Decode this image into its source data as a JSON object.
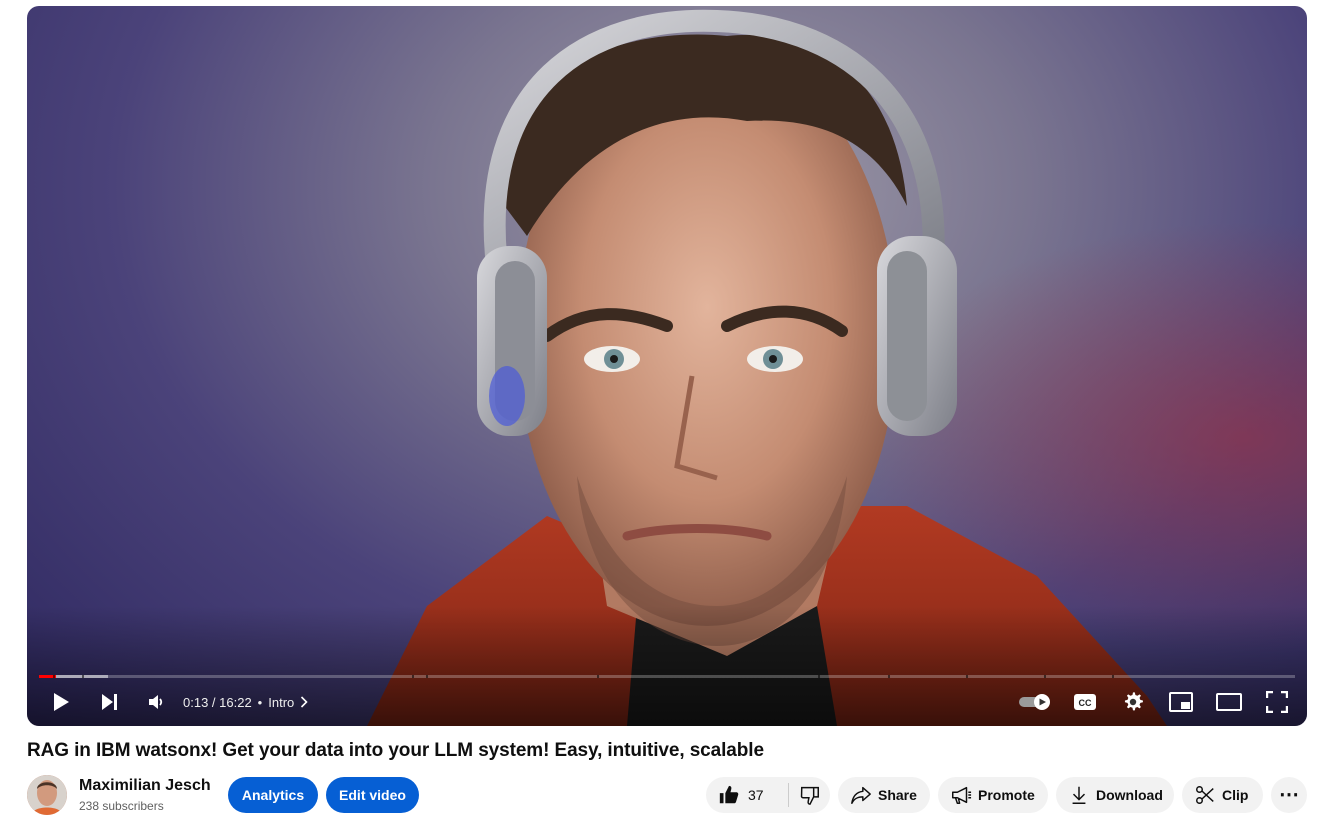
{
  "player": {
    "time_display": "0:13 / 16:22",
    "chapter_label": "Intro",
    "progress_played": 0.0134,
    "progress_loaded": 0.055,
    "chapter_markers": [
      0.011,
      0.034,
      0.297,
      0.308,
      0.444,
      0.62,
      0.676,
      0.738,
      0.8,
      0.854
    ],
    "icons": [
      "play-icon",
      "next-icon",
      "volume-icon",
      "autoplay-toggle-icon",
      "captions-icon",
      "settings-icon",
      "miniplayer-icon",
      "theater-mode-icon",
      "fullscreen-icon"
    ],
    "accent_color": "#ff0000"
  },
  "video": {
    "title": "RAG in IBM watsonx! Get your data into your LLM system! Easy, intuitive, scalable"
  },
  "channel": {
    "name": "Maximilian Jesch",
    "subscribers": "238 subscribers"
  },
  "actions": {
    "analytics_label": "Analytics",
    "edit_label": "Edit video",
    "like_count": "37",
    "share_label": "Share",
    "promote_label": "Promote",
    "download_label": "Download",
    "clip_label": "Clip",
    "more_label": "⋯",
    "primary_color": "#065fd4"
  }
}
